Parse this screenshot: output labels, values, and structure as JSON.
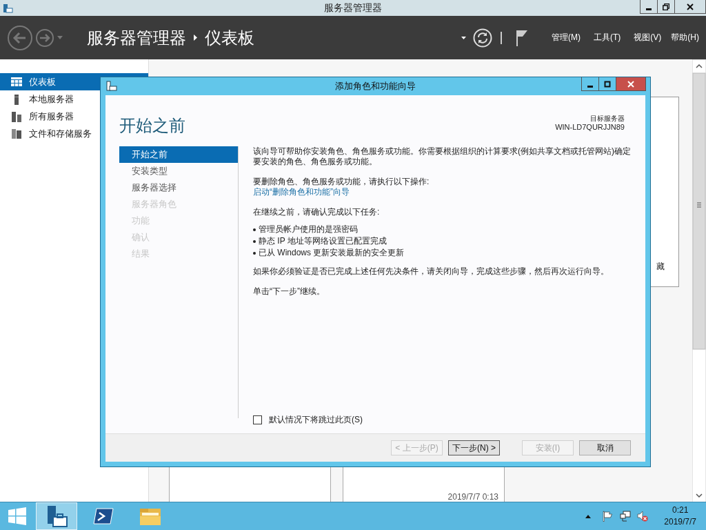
{
  "window": {
    "title": "服务器管理器"
  },
  "header": {
    "breadcrumb": [
      "服务器管理器",
      "仪表板"
    ],
    "menus": [
      "管理(M)",
      "工具(T)",
      "视图(V)",
      "帮助(H)"
    ]
  },
  "sidebar": {
    "items": [
      {
        "label": "仪表板",
        "selected": true
      },
      {
        "label": "本地服务器",
        "selected": false
      },
      {
        "label": "所有服务器",
        "selected": false
      },
      {
        "label": "文件和存储服务",
        "selected": false
      }
    ]
  },
  "background": {
    "panel_text": "藏",
    "tile_time": "2019/7/7 0:13"
  },
  "dialog": {
    "title": "添加角色和功能向导",
    "heading": "开始之前",
    "target_label": "目标服务器",
    "target_name": "WIN-LD7QURJJN89",
    "steps": [
      {
        "label": "开始之前",
        "selected": true,
        "disabled": false
      },
      {
        "label": "安装类型",
        "selected": false,
        "disabled": false
      },
      {
        "label": "服务器选择",
        "selected": false,
        "disabled": false
      },
      {
        "label": "服务器角色",
        "selected": false,
        "disabled": true
      },
      {
        "label": "功能",
        "selected": false,
        "disabled": true
      },
      {
        "label": "确认",
        "selected": false,
        "disabled": true
      },
      {
        "label": "结果",
        "selected": false,
        "disabled": true
      }
    ],
    "intro": "该向导可帮助你安装角色、角色服务或功能。你需要根据组织的计算要求(例如共享文档或托管网站)确定要安装的角色、角色服务或功能。",
    "remove_prompt": "要删除角色、角色服务或功能，请执行以下操作:",
    "remove_link": "启动“删除角色和功能”向导",
    "before_prompt": "在继续之前，请确认完成以下任务:",
    "bullets": [
      "管理员帐户使用的是强密码",
      "静态 IP 地址等网络设置已配置完成",
      "已从 Windows 更新安装最新的安全更新"
    ],
    "verify": "如果你必须验证是否已完成上述任何先决条件，请关闭向导，完成这些步骤，然后再次运行向导。",
    "next_hint": "单击“下一步”继续。",
    "skip_checkbox": {
      "label": "默认情况下将跳过此页(S)",
      "checked": false
    },
    "buttons": [
      {
        "label": "< 上一步(P)",
        "disabled": true,
        "focused": false
      },
      {
        "label": "下一步(N) >",
        "disabled": false,
        "focused": true
      },
      {
        "label": "安装(I)",
        "disabled": true,
        "focused": false
      },
      {
        "label": "取消",
        "disabled": false,
        "focused": false
      }
    ]
  },
  "taskbar": {
    "apps": [
      {
        "selected": true
      },
      {
        "selected": false
      },
      {
        "selected": false
      }
    ],
    "clock": {
      "time": "0:21",
      "date": "2019/7/7"
    }
  }
}
